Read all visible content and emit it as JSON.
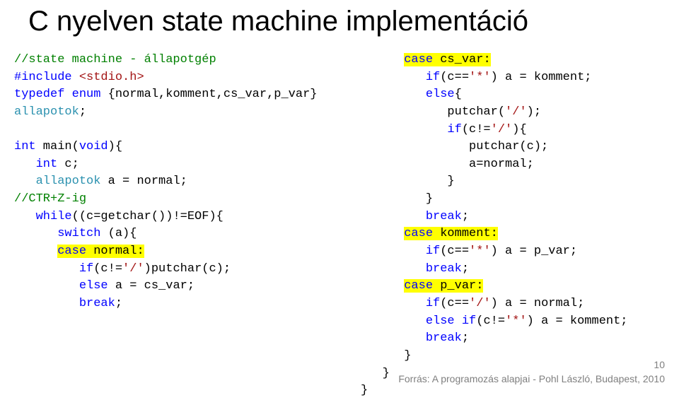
{
  "title": "C nyelven state machine implementáció",
  "code_left": {
    "l1": {
      "a": "//state machine - állapotgép"
    },
    "l2": {
      "a": "#include",
      "b": " ",
      "c": "<stdio.h>"
    },
    "l3": {
      "a": "typedef",
      "b": " ",
      "c": "enum",
      "d": " {normal,komment,cs_var,p_var}"
    },
    "l4": {
      "a": "allapotok",
      "b": ";"
    },
    "blank1": "",
    "l5": {
      "a": "int",
      "b": " main(",
      "c": "void",
      "d": "){"
    },
    "l6": {
      "a": "   ",
      "b": "int",
      "c": " c;"
    },
    "l7": {
      "a": "   ",
      "b": "allapotok",
      "c": " a = normal;"
    },
    "l8": {
      "a": "//CTR+Z-ig"
    },
    "l9": {
      "a": "   ",
      "b": "while",
      "c": "((c=getchar())!=EOF){"
    },
    "l10": {
      "a": "      ",
      "b": "switch",
      "c": " (a){"
    },
    "l11": {
      "a": "      ",
      "b": "case",
      "c": " normal:"
    },
    "l12": {
      "a": "         ",
      "b": "if",
      "c": "(c!=",
      "d": "'/'",
      "e": ")putchar(c);"
    },
    "l13": {
      "a": "         ",
      "b": "else",
      "c": " a = cs_var;"
    },
    "l14": {
      "a": "         ",
      "b": "break",
      "c": ";"
    }
  },
  "code_right": {
    "l1": {
      "a": "      ",
      "b1": "case",
      "b2": " cs_var:"
    },
    "l2": {
      "a": "         ",
      "b": "if",
      "c": "(c==",
      "d": "'*'",
      "e": ") a = komment;"
    },
    "l3": {
      "a": "         ",
      "b": "else",
      "c": "{"
    },
    "l4": {
      "a": "            putchar(",
      "b": "'/'",
      "c": ");"
    },
    "l5": {
      "a": "            ",
      "b": "if",
      "c": "(c!=",
      "d": "'/'",
      "e": "){"
    },
    "l6": {
      "a": "               putchar(c);"
    },
    "l7": {
      "a": "               a=normal;"
    },
    "l8": {
      "a": "            }"
    },
    "l9": {
      "a": "         }"
    },
    "l10": {
      "a": "         ",
      "b": "break",
      "c": ";"
    },
    "l11": {
      "a": "      ",
      "b1": "case",
      "b2": " komment:"
    },
    "l12": {
      "a": "         ",
      "b": "if",
      "c": "(c==",
      "d": "'*'",
      "e": ") a = p_var;"
    },
    "l13": {
      "a": "         ",
      "b": "break",
      "c": ";"
    },
    "l14": {
      "a": "      ",
      "b1": "case",
      "b2": " p_var:"
    },
    "l15": {
      "a": "         ",
      "b": "if",
      "c": "(c==",
      "d": "'/'",
      "e": ") a = normal;"
    },
    "l16": {
      "a": "         ",
      "b": "else",
      "c": " ",
      "d": "if",
      "e": "(c!=",
      "f": "'*'",
      "g": ") a = komment;"
    },
    "l17": {
      "a": "         ",
      "b": "break",
      "c": ";"
    },
    "l18": {
      "a": "      }"
    },
    "l19": {
      "a": "   }"
    },
    "l20": {
      "a": "}"
    }
  },
  "footer": "Forrás: A programozás alapjai - Pohl László, Budapest, 2010",
  "pagenum": "10"
}
